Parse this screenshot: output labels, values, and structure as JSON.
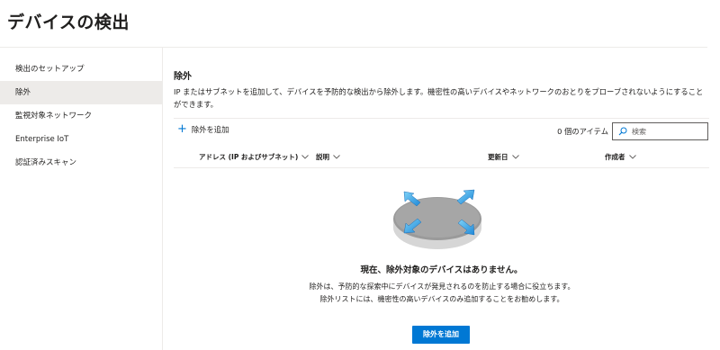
{
  "page": {
    "title": "デバイスの検出"
  },
  "sidebar": {
    "items": [
      {
        "label": "検出のセットアップ",
        "active": false
      },
      {
        "label": "除外",
        "active": true
      },
      {
        "label": "監視対象ネットワーク",
        "active": false
      },
      {
        "label": "Enterprise IoT",
        "active": false
      },
      {
        "label": "認証済みスキャン",
        "active": false
      }
    ]
  },
  "main": {
    "section_title": "除外",
    "description": "IP またはサブネットを追加して、デバイスを予防的な検出から除外します。機密性の高いデバイスやネットワークのおとりをプローブされないようにすることができます。",
    "toolbar": {
      "add_label": "除外を追加",
      "item_count": "0 個のアイテム",
      "search_placeholder": "検索"
    },
    "columns": [
      {
        "label": "アドレス (IP およびサブネット)"
      },
      {
        "label": "説明"
      },
      {
        "label": "更新日"
      },
      {
        "label": "作成者"
      }
    ],
    "empty_state": {
      "title": "現在、除外対象のデバイスはありません。",
      "description": "除外は、予防的な探索中にデバイスが発見されるのを防止する場合に役立ちます。除外リストには、機密性の高いデバイスのみ追加することをお勧めします。",
      "button_label": "除外を追加"
    }
  },
  "colors": {
    "accent": "#0078d4",
    "active_bg": "#edebe9",
    "divider": "#edebe9"
  },
  "icons": {
    "add": "plus-icon",
    "search": "search-icon",
    "sort": "chevron-down-icon",
    "empty": "network-router-icon"
  }
}
